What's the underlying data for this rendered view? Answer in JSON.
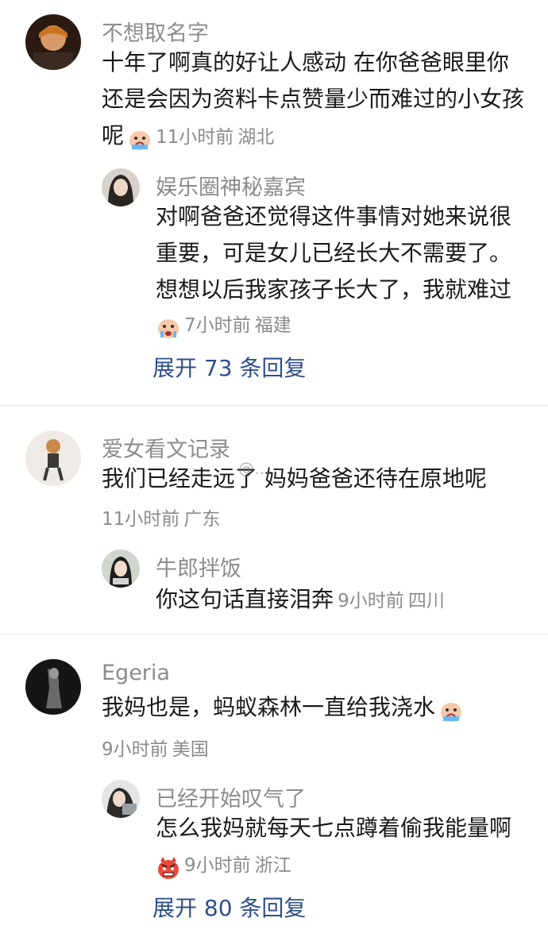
{
  "comments": [
    {
      "user": "不想取名字",
      "lines": [
        "十年了啊真的好让人感动 在你爸爸眼里你",
        "还是会因为资料卡点赞量少而难过的小女孩",
        "呢"
      ],
      "emoji": "crying-face-emoji",
      "time": "11小时前",
      "location": "湖北",
      "reply": {
        "user": "娱乐圈神秘嘉宾",
        "lines": [
          "对啊爸爸还觉得这件事情对她来说很",
          "重要，可是女儿已经长大不需要了。",
          "想想以后我家孩子长大了，我就难过"
        ],
        "emoji": "crying-face-emoji",
        "time": "7小时前",
        "location": "福建"
      },
      "expand": "展开 73 条回复"
    },
    {
      "user": "爱女看文记录",
      "lines": [
        "我们已经走远了 妈妈爸爸还待在原地呢"
      ],
      "time": "11小时前",
      "location": "广东",
      "reply": {
        "user": "牛郎拌饭",
        "lines": [
          "你这句话直接泪奔"
        ],
        "time": "9小时前",
        "location": "四川"
      }
    },
    {
      "user": "Egeria",
      "lines": [
        "我妈也是，蚂蚁森林一直给我浇水"
      ],
      "emoji": "crying-face-emoji",
      "time": "9小时前",
      "location": "美国",
      "reply": {
        "user": "已经开始叹气了",
        "lines": [
          "怎么我妈就每天七点蹲着偷我能量啊"
        ],
        "emoji": "angry-face-emoji",
        "time": "9小时前",
        "location": "浙江"
      },
      "expand": "展开 80 条回复"
    }
  ],
  "watermark": "@…"
}
